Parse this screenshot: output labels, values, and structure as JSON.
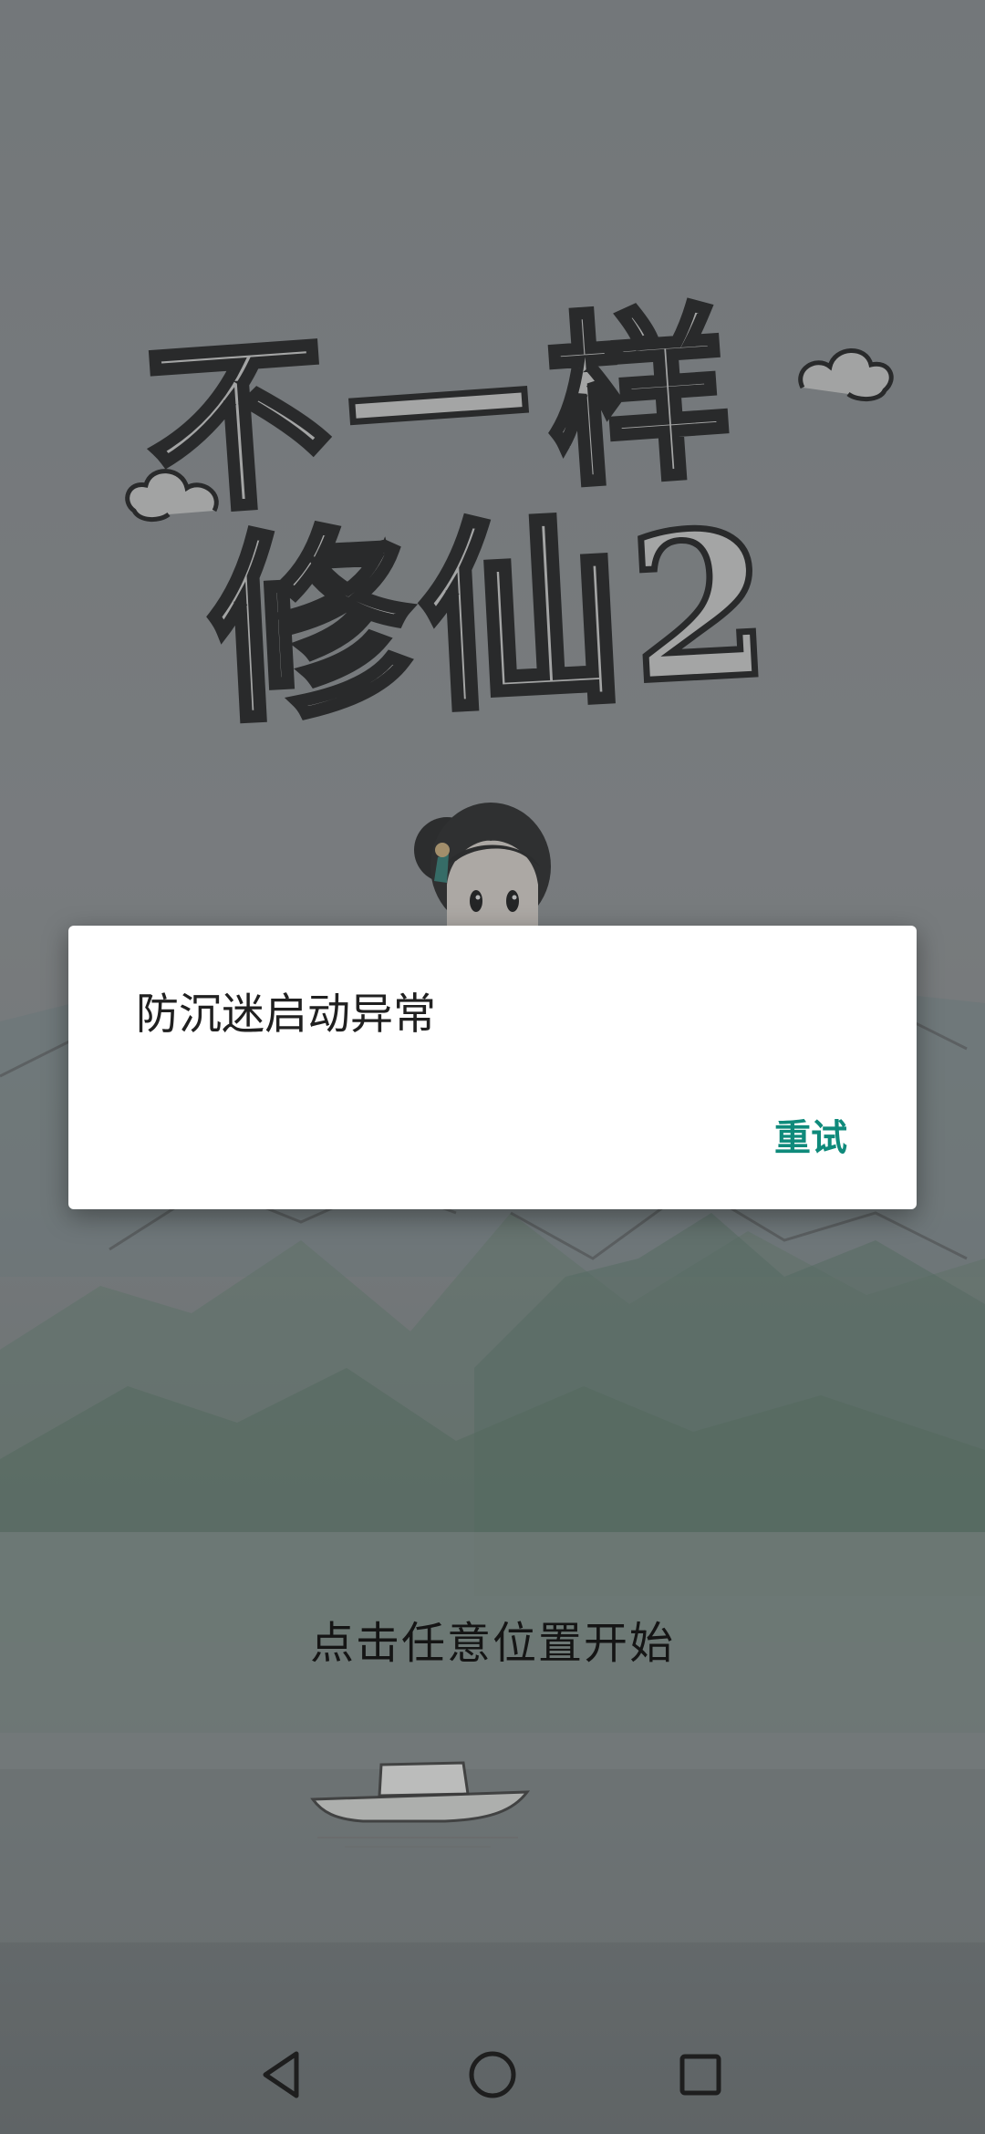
{
  "game": {
    "title_line1": "不一样",
    "title_line2": "修仙2",
    "tap_to_start": "点击任意位置开始"
  },
  "dialog": {
    "message": "防沉迷启动异常",
    "retry_label": "重试",
    "accent_color": "#0f8a7b"
  },
  "nav_bar": {
    "back_icon": "triangle-back-icon",
    "home_icon": "circle-home-icon",
    "recents_icon": "square-recents-icon"
  }
}
